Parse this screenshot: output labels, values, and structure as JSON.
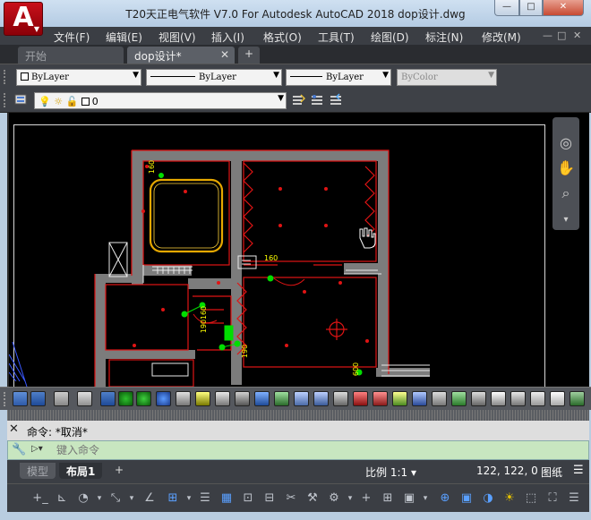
{
  "window": {
    "title": "T20天正电气软件 V7.0 For Autodesk AutoCAD 2018     dop设计.dwg",
    "logo_letter": "A",
    "logo_dropdown": "▼",
    "min": "—",
    "max": "□",
    "close": "✕"
  },
  "menu": {
    "items": [
      "文件(F)",
      "编辑(E)",
      "视图(V)",
      "插入(I)",
      "格式(O)",
      "工具(T)",
      "绘图(D)",
      "标注(N)",
      "修改(M)"
    ],
    "mdi_min": "—",
    "mdi_restore": "□",
    "mdi_close": "✕"
  },
  "tabs": {
    "start": "开始",
    "active": "dop设计*",
    "active_close": "✕",
    "add": "+"
  },
  "properties": {
    "color": "ByLayer",
    "linetype": "ByLayer",
    "lineweight": "ByLayer",
    "plotstyle": "ByColor",
    "arrow": "▼"
  },
  "layer": {
    "current": "0",
    "arrow": "▼"
  },
  "drawing": {
    "dimensions": [
      "160",
      "160",
      "160",
      "190",
      "190",
      "600"
    ]
  },
  "command": {
    "history": "命令: *取消*",
    "placeholder": "键入命令",
    "close": "✕",
    "wrench": "🔧",
    "prompt": "▷▾"
  },
  "status": {
    "layouts": [
      "模型",
      "布局1"
    ],
    "add": "+",
    "scale": "比例 1:1 ▾",
    "coords": "122, 122, 0",
    "paper": "图纸",
    "menu": "☰"
  },
  "colors": {
    "wall": "#e01414",
    "wall_fill": "#808080",
    "fixture": "#e6a800",
    "dim": "#ffff00",
    "device_green": "#00dd00",
    "background": "#000000"
  }
}
